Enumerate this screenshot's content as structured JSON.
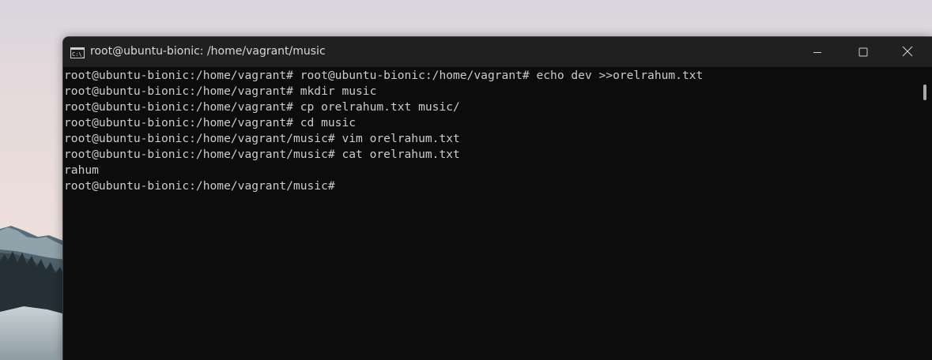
{
  "window": {
    "title": "root@ubuntu-bionic: /home/vagrant/music",
    "icon": "console-icon"
  },
  "controls": {
    "minimize_icon": "minimize-icon",
    "maximize_icon": "maximize-icon",
    "close_icon": "close-icon"
  },
  "terminal": {
    "lines": [
      "root@ubuntu-bionic:/home/vagrant# root@ubuntu-bionic:/home/vagrant# echo dev >>orelrahum.txt",
      "root@ubuntu-bionic:/home/vagrant# mkdir music",
      "root@ubuntu-bionic:/home/vagrant# cp orelrahum.txt music/",
      "root@ubuntu-bionic:/home/vagrant# cd music",
      "root@ubuntu-bionic:/home/vagrant/music# vim orelrahum.txt",
      "root@ubuntu-bionic:/home/vagrant/music# cat orelrahum.txt",
      "rahum",
      "root@ubuntu-bionic:/home/vagrant/music#"
    ]
  },
  "colors": {
    "terminal_bg": "#0c0c0c",
    "terminal_fg": "#cccccc",
    "titlebar_bg": "#202020"
  }
}
